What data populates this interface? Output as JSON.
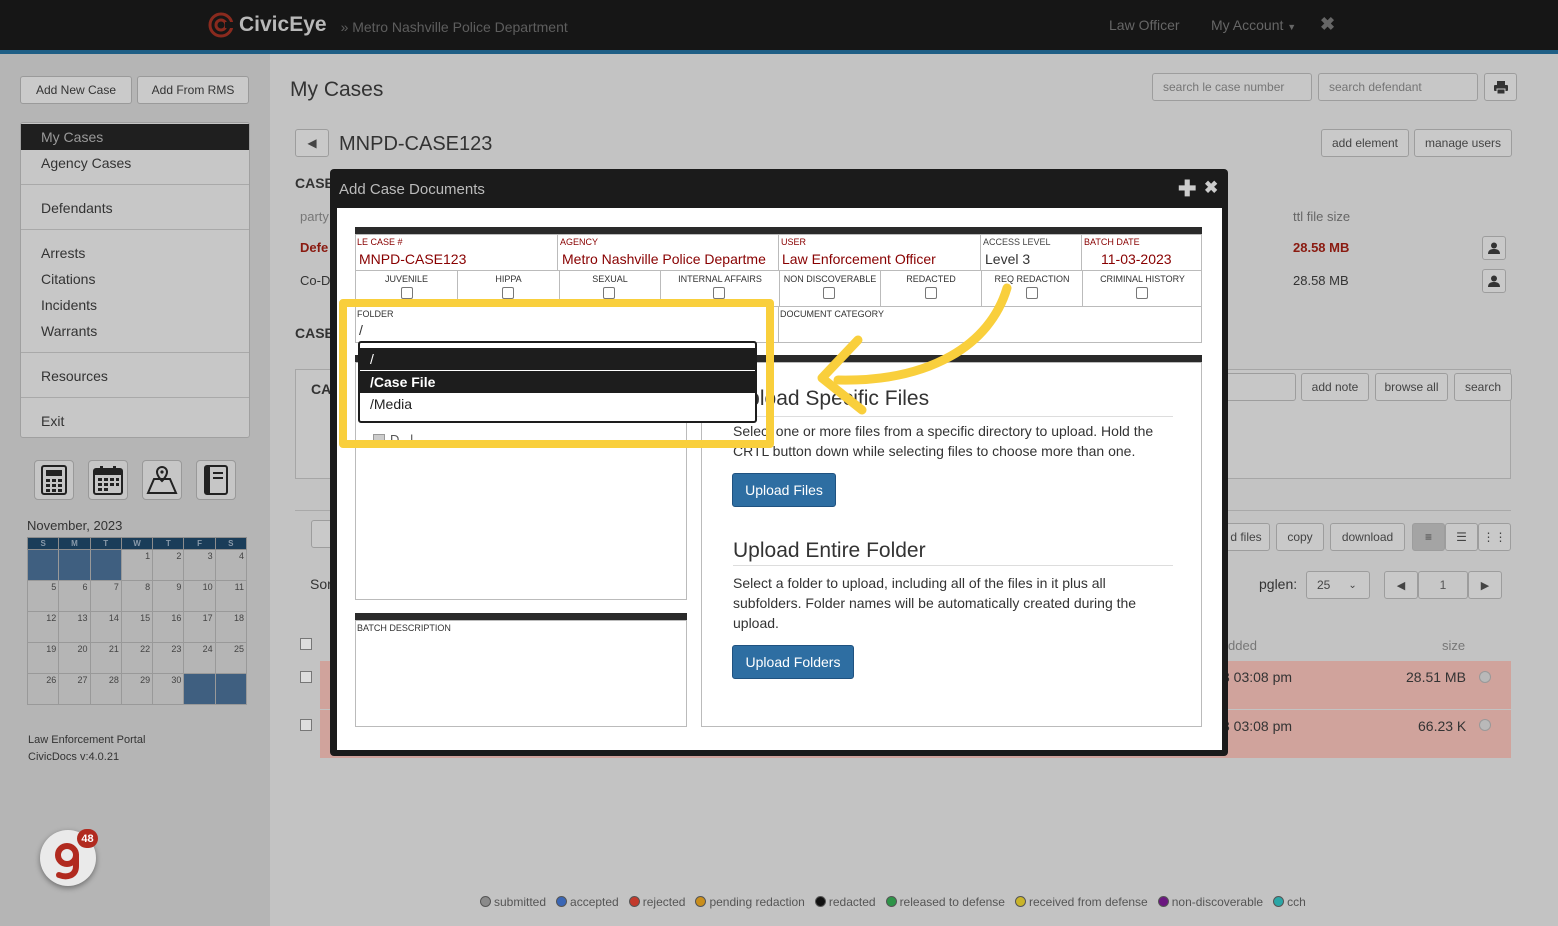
{
  "header": {
    "brand": "CivicEye",
    "agency": "» Metro Nashville Police Department",
    "nav": [
      "Law Officer",
      "My Account"
    ]
  },
  "sidebar": {
    "buttons": [
      "Add New Case",
      "Add From RMS"
    ],
    "menu": [
      "My Cases",
      "Agency Cases",
      "Defendants",
      "Arrests",
      "Citations",
      "Incidents",
      "Warrants",
      "Resources",
      "Exit"
    ],
    "calendar": {
      "title": "November, 2023",
      "days": [
        "S",
        "M",
        "T",
        "W",
        "T",
        "F",
        "S"
      ],
      "weeks": [
        [
          "",
          "",
          "",
          "1",
          "2",
          "3",
          "4"
        ],
        [
          "5",
          "6",
          "7",
          "8",
          "9",
          "10",
          "11"
        ],
        [
          "12",
          "13",
          "14",
          "15",
          "16",
          "17",
          "18"
        ],
        [
          "19",
          "20",
          "21",
          "22",
          "23",
          "24",
          "25"
        ],
        [
          "26",
          "27",
          "28",
          "29",
          "30",
          "",
          ""
        ]
      ]
    },
    "portal_name": "Law Enforcement Portal",
    "version": "CivicDocs v:4.0.21"
  },
  "main": {
    "title": "My Cases",
    "search_case_placeholder": "search le case number",
    "search_defendant_placeholder": "search defendant",
    "case_number": "MNPD-CASE123",
    "add_element": "add element",
    "manage_users": "manage users",
    "bg_case_label_1": "CASE",
    "bg_case_label_2": "CASE",
    "bg_party": "party",
    "bg_def_1": "Defe",
    "bg_def_2": "Co-D",
    "bg_ca": "CA",
    "bg_sort": "Sor",
    "ttl_file_size": "ttl file size",
    "size_1": "28.58 MB",
    "size_2": "28.58 MB",
    "add_note": "add note",
    "browse_all": "browse all",
    "search": "search",
    "files_btn": "d files",
    "copy": "copy",
    "download": "download",
    "pglen_label": "pglen:",
    "pglen_value": "25",
    "page_value": "1",
    "col_added": "dded",
    "col_size": "size",
    "row1_time": "3 03:08 pm",
    "row1_size": "28.51 MB",
    "row2_time": "3 03:08 pm",
    "row2_size": "66.23 K"
  },
  "legend": [
    "submitted",
    "accepted",
    "rejected",
    "pending redaction",
    "redacted",
    "released to defense",
    "received from defense",
    "non-discoverable",
    "cch"
  ],
  "legend_colors": [
    "#8a8a8a",
    "#3a66b5",
    "#c23a2c",
    "#c98e1c",
    "#111111",
    "#2e9448",
    "#c9b42a",
    "#6b1780",
    "#2aa6a6"
  ],
  "modal": {
    "title": "Add Case Documents",
    "fields": {
      "le_case_label": "LE CASE #",
      "le_case_value": "MNPD-CASE123",
      "agency_label": "AGENCY",
      "agency_value": "Metro Nashville Police Departme",
      "user_label": "USER",
      "user_value": "Law Enforcement Officer",
      "access_label": "ACCESS LEVEL",
      "access_value": "Level 3",
      "batch_date_label": "BATCH DATE",
      "batch_date_value": "11-03-2023"
    },
    "checkboxes": [
      "JUVENILE",
      "HIPPA",
      "SEXUAL",
      "INTERNAL AFFAIRS",
      "NON DISCOVERABLE",
      "REDACTED",
      "REQ REDACTION",
      "CRIMINAL HISTORY"
    ],
    "folder_label": "FOLDER",
    "folder_value": "/",
    "folder_options": [
      "/",
      "/Case File",
      "/Media"
    ],
    "doc_category_label": "DOCUMENT CATEGORY",
    "partial_item": "D...l...",
    "batch_description_label": "BATCH DESCRIPTION",
    "upload_specific_title": "Upload Specific Files",
    "upload_specific_text": "Select one or more files from a specific directory to upload. Hold the CRTL button down while selecting files to choose more than one.",
    "upload_files_btn": "Upload Files",
    "upload_folder_title": "Upload Entire Folder",
    "upload_folder_text": "Select a folder to upload, including all of the files in it plus all subfolders. Folder names will be automatically created during the upload.",
    "upload_folders_btn": "Upload Folders"
  },
  "guide_badge": "48"
}
